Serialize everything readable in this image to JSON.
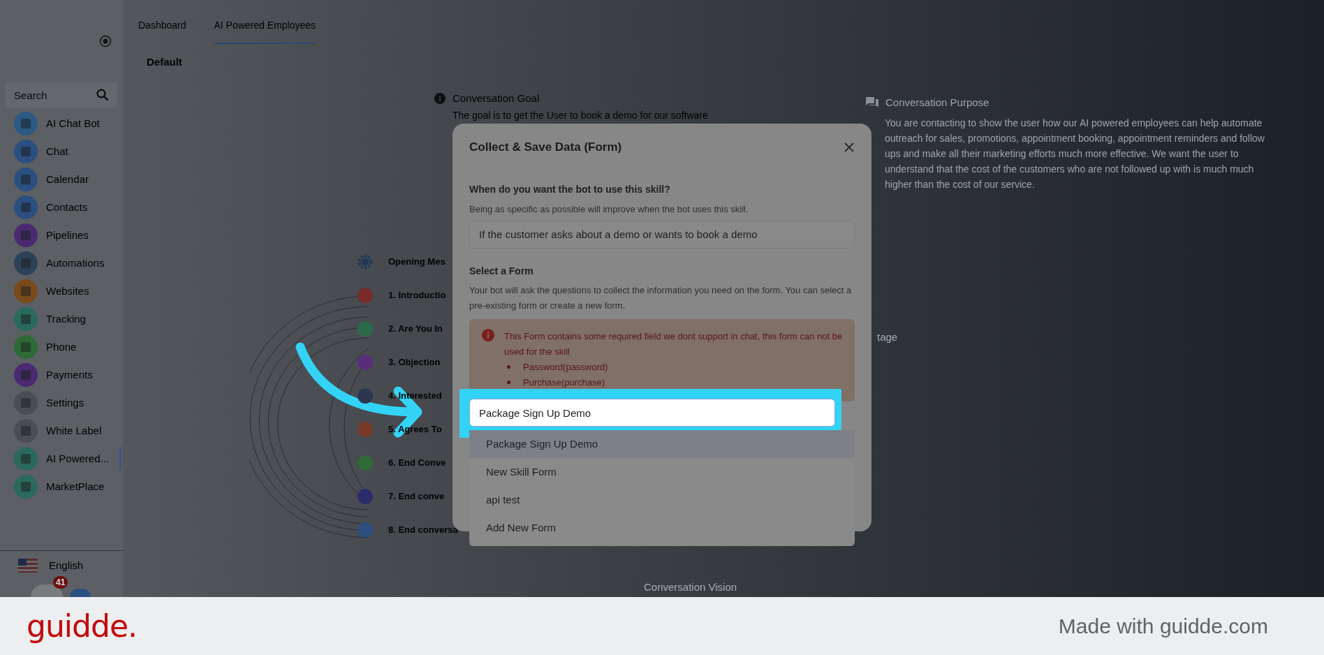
{
  "top_tabs": [
    {
      "label": "Dashboard",
      "selected": false
    },
    {
      "label": "AI Powered Employees",
      "selected": true
    }
  ],
  "subtab": "Default",
  "sidebar": {
    "search": {
      "placeholder": "Search"
    },
    "items": [
      {
        "label": "AI Chat Bot",
        "color": "#2b5a85",
        "selected": false
      },
      {
        "label": "Chat",
        "color": "#2b4f80",
        "selected": false
      },
      {
        "label": "Calendar",
        "color": "#2b4f80",
        "selected": false
      },
      {
        "label": "Contacts",
        "color": "#2b4f80",
        "selected": false
      },
      {
        "label": "Pipelines",
        "color": "#4a2a70",
        "selected": false
      },
      {
        "label": "Automations",
        "color": "#2d4258",
        "selected": false
      },
      {
        "label": "Websites",
        "color": "#7a4a1a",
        "selected": false
      },
      {
        "label": "Tracking",
        "color": "#2a6a5a",
        "selected": false
      },
      {
        "label": "Phone",
        "color": "#2d6a35",
        "selected": false
      },
      {
        "label": "Payments",
        "color": "#4a2a70",
        "selected": false
      },
      {
        "label": "Settings",
        "color": "#4a4d52",
        "selected": false
      },
      {
        "label": "White Label",
        "color": "#4a4d52",
        "selected": false
      },
      {
        "label": "AI Powered...",
        "color": "#2a6a5a",
        "selected": true
      },
      {
        "label": "MarketPlace",
        "color": "#2a6a5a",
        "selected": false
      }
    ],
    "language": "English",
    "badge": "41"
  },
  "conversation_goal": {
    "title": "Conversation Goal",
    "text": "The goal is to get the User to book a demo for our software"
  },
  "conversation_purpose": {
    "title": "Conversation Purpose",
    "text": "You are contacting to show the user how our AI powered employees can help automate outreach for sales, promotions, appointment booking, appointment reminders and follow ups and make all their marketing efforts much more effective. We want the user to understand that the cost of the customers who are not followed up with is much much higher than the cost of our service."
  },
  "stage_label": "tage",
  "conversation_vision": "Conversation Vision",
  "stages": [
    {
      "label": "Opening Mes",
      "kind": "settings"
    },
    {
      "label": "1. Introductio",
      "kind": "node",
      "color": "#7a2a2a"
    },
    {
      "label": "2. Are You In",
      "kind": "node",
      "color": "#2a6a4a"
    },
    {
      "label": "3. Objection",
      "kind": "node",
      "color": "#5a2d7a"
    },
    {
      "label": "4. Interested",
      "kind": "node",
      "color": "#2c3650"
    },
    {
      "label": "5. Agrees To",
      "kind": "node",
      "color": "#7a3a2a"
    },
    {
      "label": "6. End Conve",
      "kind": "node",
      "color": "#2d6a35"
    },
    {
      "label": "7. End conve",
      "kind": "node",
      "color": "#2c2c6a"
    },
    {
      "label": "8. End conversa",
      "kind": "node",
      "color": "#2c4f80"
    }
  ],
  "dialog": {
    "title": "Collect & Save Data (Form)",
    "when_label": "When do you want the bot to use this skill?",
    "when_help": "Being as specific as possible will improve when the bot uses this skill.",
    "when_value": "If the customer asks about a demo or wants to book a demo",
    "form_label": "Select a Form",
    "form_help": "Your bot will ask the questions to collect the information you need on the form. You can select a pre-existing form or create a new form.",
    "warning": {
      "text": "This Form contains some required field we dont support in chat, this form can not be used for the skill",
      "items": [
        "Password(password)",
        "Purchase(purchase)"
      ]
    },
    "form_value": "Package Sign Up Demo",
    "options": [
      {
        "label": "Package Sign Up Demo",
        "selected": true
      },
      {
        "label": "New Skill Form",
        "selected": false
      },
      {
        "label": "api test",
        "selected": false
      },
      {
        "label": "Add New Form",
        "selected": false
      }
    ]
  },
  "footer": {
    "logo": "guidde.",
    "text": "Made with guidde.com"
  }
}
